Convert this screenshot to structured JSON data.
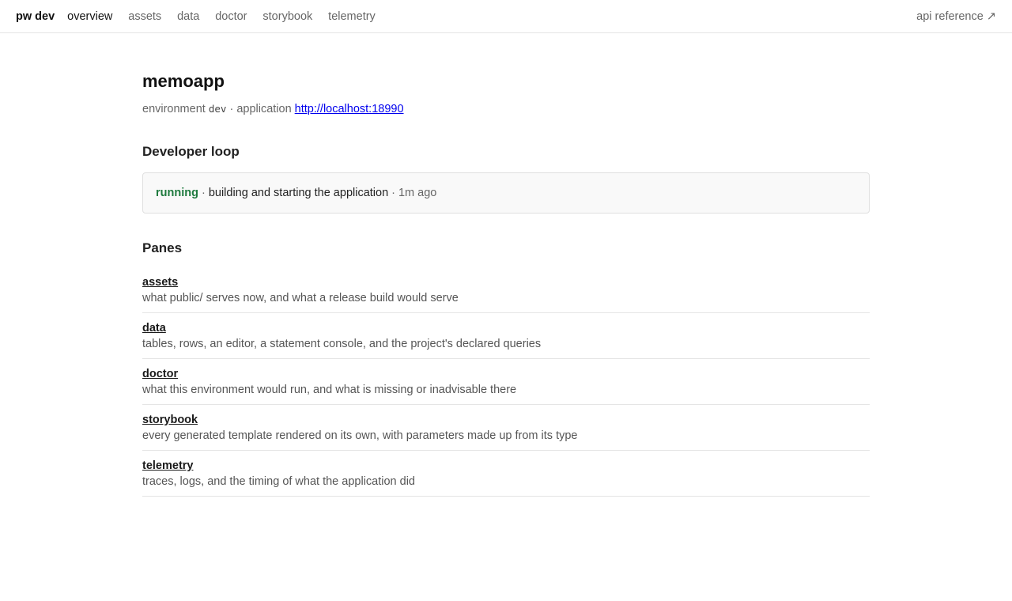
{
  "topbar": {
    "brand": "pw dev",
    "nav": [
      "overview",
      "assets",
      "data",
      "doctor",
      "storybook",
      "telemetry"
    ],
    "api_reference": "api reference ↗"
  },
  "header": {
    "title": "memoapp",
    "env_label": "environment",
    "env_value": "dev",
    "sep": "·",
    "app_label": "application",
    "app_url": "http://localhost:18990"
  },
  "loop": {
    "heading": "Developer loop",
    "status": "running",
    "message": "building and starting the application",
    "ago": "1m ago",
    "status_color": "#1e7a3e"
  },
  "panes": {
    "heading": "Panes",
    "items": [
      {
        "name": "assets",
        "desc": "what public/ serves now, and what a release build would serve"
      },
      {
        "name": "data",
        "desc": "tables, rows, an editor, a statement console, and the project's declared queries"
      },
      {
        "name": "doctor",
        "desc": "what this environment would run, and what is missing or inadvisable there"
      },
      {
        "name": "storybook",
        "desc": "every generated template rendered on its own, with parameters made up from its type"
      },
      {
        "name": "telemetry",
        "desc": "traces, logs, and the timing of what the application did"
      }
    ]
  }
}
